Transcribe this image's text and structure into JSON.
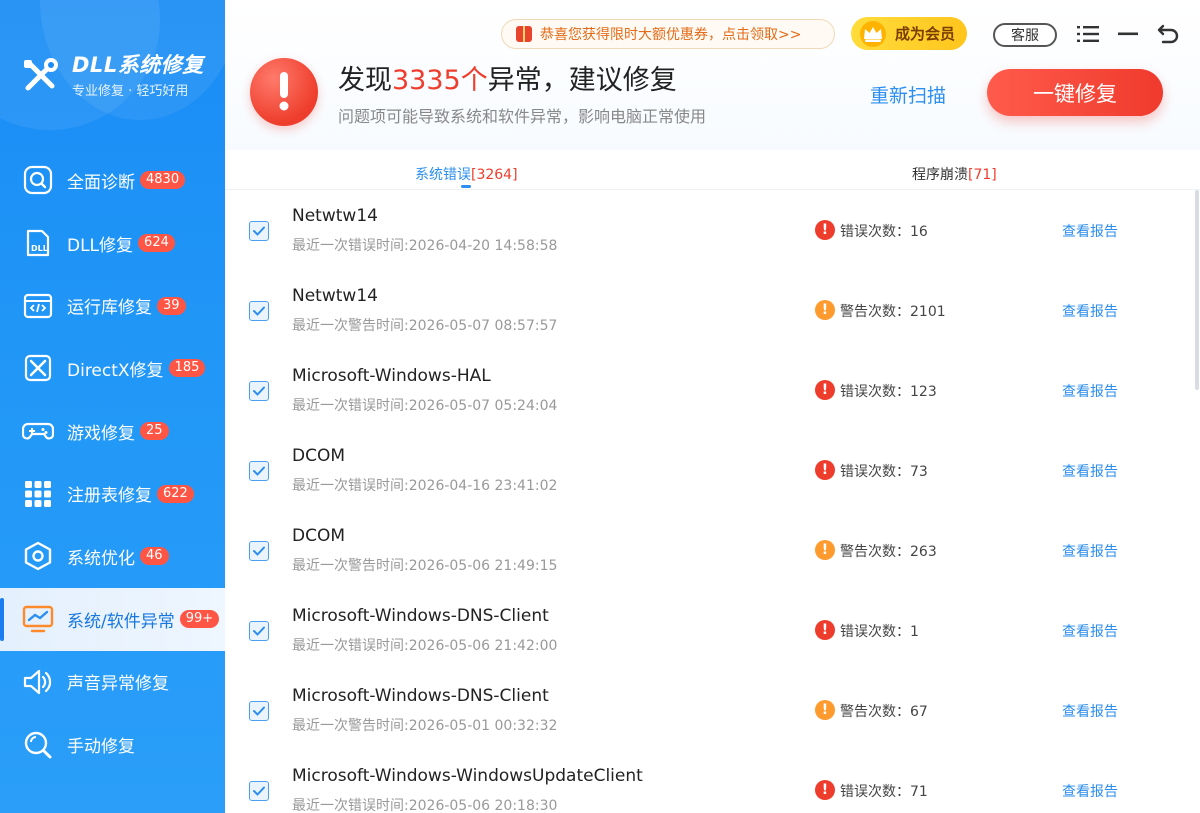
{
  "app": {
    "title": "DLL系统修复",
    "subtitle": "专业修复 · 轻巧好用"
  },
  "sidebar": {
    "items": [
      {
        "label": "全面诊断",
        "badge": "4830",
        "icon": "magnifier-icon"
      },
      {
        "label": "DLL修复",
        "badge": "624",
        "icon": "dll-file-icon"
      },
      {
        "label": "运行库修复",
        "badge": "39",
        "icon": "code-window-icon"
      },
      {
        "label": "DirectX修复",
        "badge": "185",
        "icon": "directx-icon"
      },
      {
        "label": "游戏修复",
        "badge": "25",
        "icon": "gamepad-icon"
      },
      {
        "label": "注册表修复",
        "badge": "622",
        "icon": "grid-icon"
      },
      {
        "label": "系统优化",
        "badge": "46",
        "icon": "hexagon-icon"
      },
      {
        "label": "系统/软件异常",
        "badge": "99+",
        "icon": "monitor-chart-icon",
        "active": true
      },
      {
        "label": "声音异常修复",
        "badge": "",
        "icon": "speaker-icon"
      },
      {
        "label": "手动修复",
        "badge": "",
        "icon": "manual-search-icon"
      }
    ]
  },
  "topbar": {
    "promo": "恭喜您获得限时大额优惠券，点击领取>>",
    "vip": "成为会员",
    "service": "客服"
  },
  "summary": {
    "prefix": "发现",
    "count": "3335个",
    "suffix": "异常，建议修复",
    "description": "问题项可能导致系统和软件异常，影响电脑正常使用",
    "rescan": "重新扫描",
    "fix_all": "一键修复"
  },
  "tabs": [
    {
      "label": "系统错误",
      "count": "[3264]",
      "active": true
    },
    {
      "label": "程序崩溃",
      "count": "[71]",
      "active": false
    }
  ],
  "rows": [
    {
      "name": "Netwtw14",
      "time": "最近一次错误时间:2026-04-20 14:58:58",
      "type": "error",
      "stat": "错误次数：16",
      "report": "查看报告"
    },
    {
      "name": "Netwtw14",
      "time": "最近一次警告时间:2026-05-07 08:57:57",
      "type": "warn",
      "stat": "警告次数：2101",
      "report": "查看报告"
    },
    {
      "name": "Microsoft-Windows-HAL",
      "time": "最近一次错误时间:2026-05-07 05:24:04",
      "type": "error",
      "stat": "错误次数：123",
      "report": "查看报告"
    },
    {
      "name": "DCOM",
      "time": "最近一次错误时间:2026-04-16 23:41:02",
      "type": "error",
      "stat": "错误次数：73",
      "report": "查看报告"
    },
    {
      "name": "DCOM",
      "time": "最近一次警告时间:2026-05-06 21:49:15",
      "type": "warn",
      "stat": "警告次数：263",
      "report": "查看报告"
    },
    {
      "name": "Microsoft-Windows-DNS-Client",
      "time": "最近一次错误时间:2026-05-06 21:42:00",
      "type": "error",
      "stat": "错误次数：1",
      "report": "查看报告"
    },
    {
      "name": "Microsoft-Windows-DNS-Client",
      "time": "最近一次警告时间:2026-05-01 00:32:32",
      "type": "warn",
      "stat": "警告次数：67",
      "report": "查看报告"
    },
    {
      "name": "Microsoft-Windows-WindowsUpdateClient",
      "time": "最近一次错误时间:2026-05-06 20:18:30",
      "type": "error",
      "stat": "错误次数：71",
      "report": "查看报告"
    }
  ],
  "colors": {
    "sidebar": "#1a8cf5",
    "accent": "#2b8ef0",
    "danger": "#ee3d2c",
    "warning": "#ff9a2e"
  }
}
